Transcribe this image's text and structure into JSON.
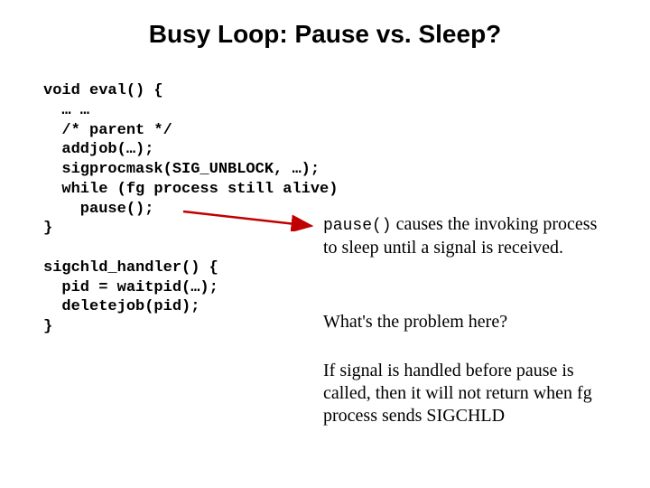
{
  "title": "Busy Loop: Pause vs. Sleep?",
  "code": {
    "l1": "void eval() {",
    "l2": "  … …",
    "l3": "  /* parent */",
    "l4": "  addjob(…);",
    "l5": "  sigprocmask(SIG_UNBLOCK, …);",
    "l6": "  while (fg process still alive)",
    "l7": "    pause();",
    "l8": "}",
    "l9": "",
    "l10": "sigchld_handler() {",
    "l11": "  pid = waitpid(…);",
    "l12": "  deletejob(pid);",
    "l13": "}"
  },
  "annot": {
    "pause_fn": "pause()",
    "pause_desc_rest": " causes the invoking process to sleep until a signal is received.",
    "question": "What's the problem here?",
    "problem": "If signal is handled before pause is called, then it will not return when fg process sends SIGCHLD"
  }
}
